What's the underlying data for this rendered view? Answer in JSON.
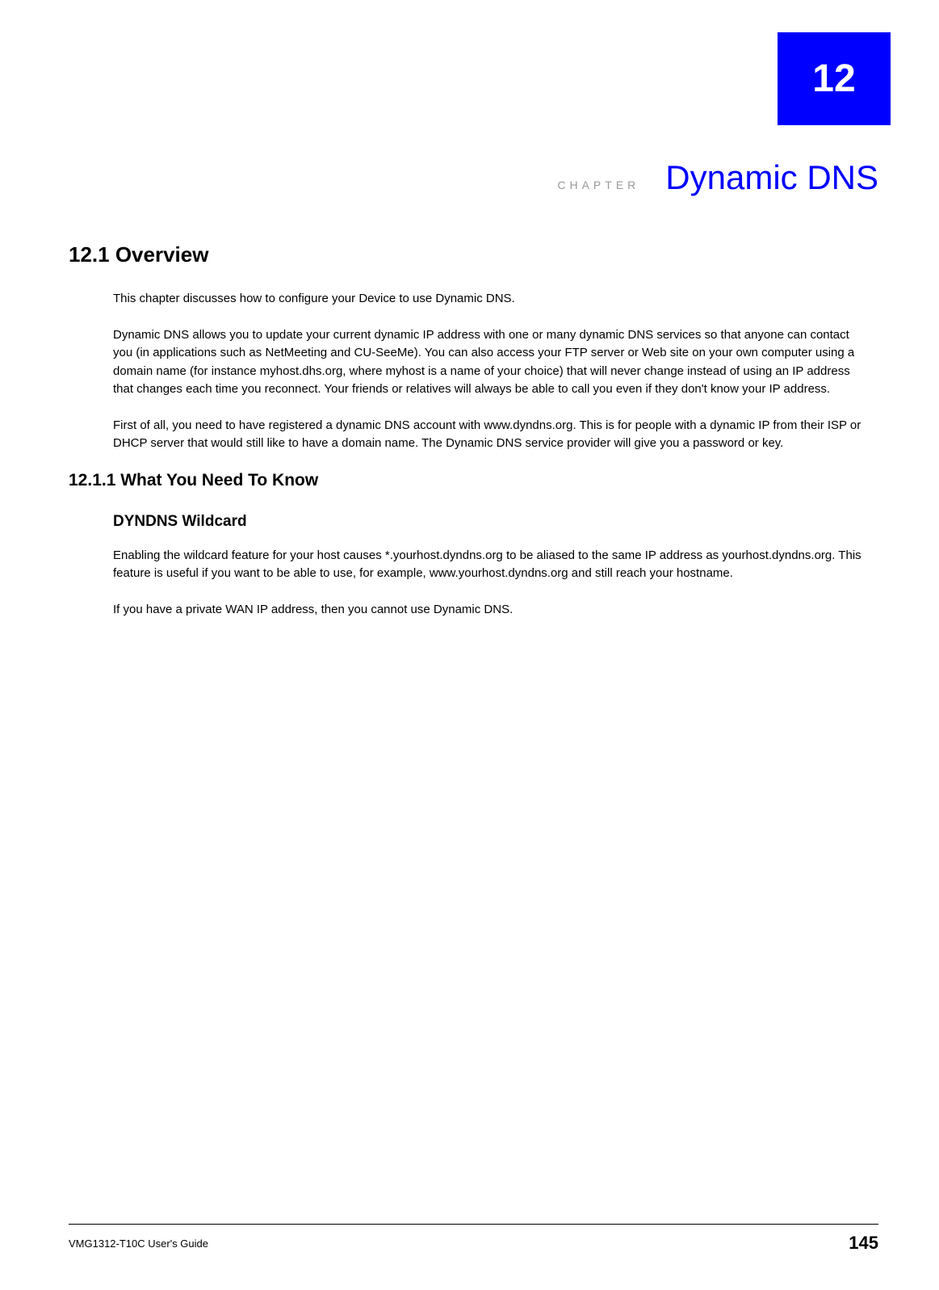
{
  "chapter": {
    "number": "12",
    "label": "CHAPTER",
    "title": "Dynamic DNS"
  },
  "sections": {
    "overview": {
      "heading": "12.1  Overview",
      "p1": "This chapter discusses how to configure your Device to use Dynamic DNS.",
      "p2": "Dynamic DNS allows you to update your current dynamic IP address with one or many dynamic DNS services so that anyone can contact you (in applications such as NetMeeting and CU-SeeMe). You can also access your FTP server or Web site on your own computer using a domain name (for instance myhost.dhs.org, where myhost is a name of your choice) that will never change instead of using an IP address that changes each time you reconnect. Your friends or relatives will always be able to call you even if they don't know your IP address.",
      "p3": "First of all, you need to have registered a dynamic DNS account with www.dyndns.org. This is for people with a dynamic IP from their ISP or DHCP server that would still like to have a domain name. The Dynamic DNS service provider will give you a password or key."
    },
    "whatYouNeed": {
      "heading": "12.1.1  What You Need To Know",
      "wildcardHeading": "DYNDNS Wildcard",
      "p1": "Enabling the wildcard feature for your host causes *.yourhost.dyndns.org to be aliased to the same IP address as yourhost.dyndns.org. This feature is useful if you want to be able to use, for example, www.yourhost.dyndns.org and still reach your hostname.",
      "p2": "If you have a private WAN IP address, then you cannot use Dynamic DNS."
    }
  },
  "footer": {
    "left": "VMG1312-T10C User's Guide",
    "pageNumber": "145"
  }
}
